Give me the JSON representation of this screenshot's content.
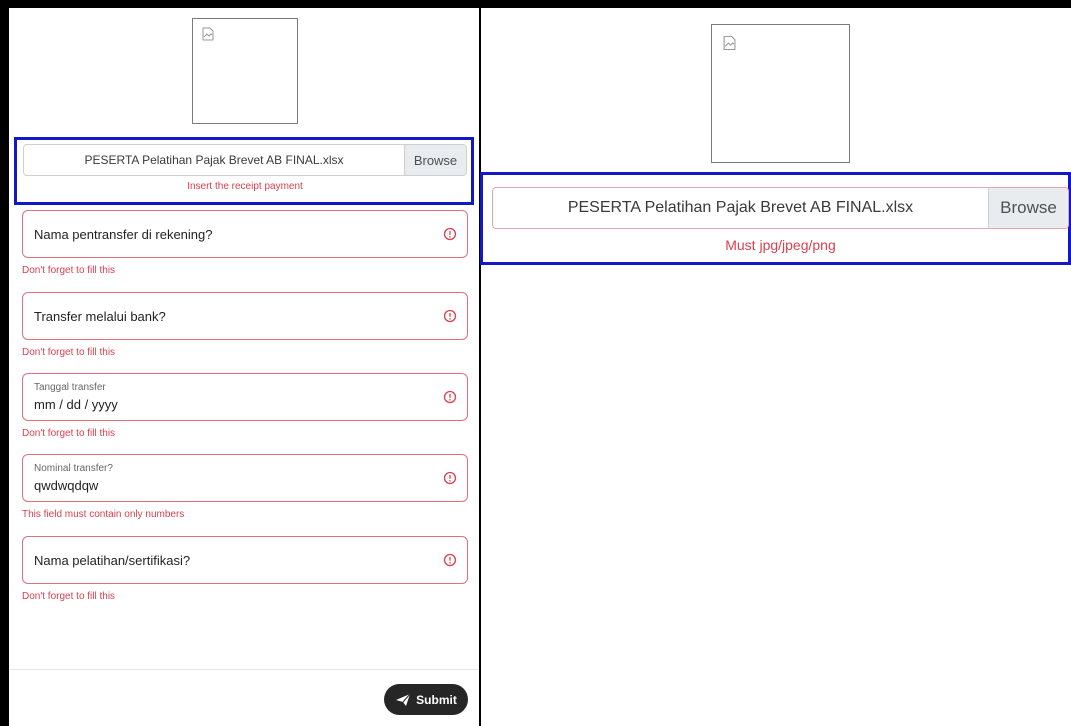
{
  "left_form": {
    "receipt_upload": {
      "file_name": "PESERTA Pelatihan Pajak Brevet AB FINAL.xlsx",
      "browse_label": "Browse",
      "error": "Insert the receipt payment"
    },
    "fields": [
      {
        "label": "Nama pentransfer di rekening?",
        "error": "Don't forget to fill this"
      },
      {
        "label": "Transfer melalui bank?",
        "error": "Don't forget to fill this"
      },
      {
        "label": "Tanggal transfer",
        "value": "mm / dd / yyyy",
        "error": "Don't forget to fill this"
      },
      {
        "label": "Nominal transfer?",
        "value": "qwdwqdqw",
        "error": "This field must contain only numbers"
      },
      {
        "label": "Nama pelatihan/sertifikasi?",
        "error": "Don't forget to fill this"
      }
    ],
    "submit_label": "Submit"
  },
  "right_form": {
    "receipt_upload": {
      "file_name": "PESERTA Pelatihan Pajak Brevet AB FINAL.xlsx",
      "browse_label": "Browse",
      "error": "Must jpg/jpeg/png"
    }
  },
  "colors": {
    "error": "#d9414f",
    "highlight": "#1218c8",
    "submit_bg": "#262626"
  },
  "icons": [
    "broken-image-icon",
    "alert-circle-icon",
    "paper-plane-icon"
  ]
}
